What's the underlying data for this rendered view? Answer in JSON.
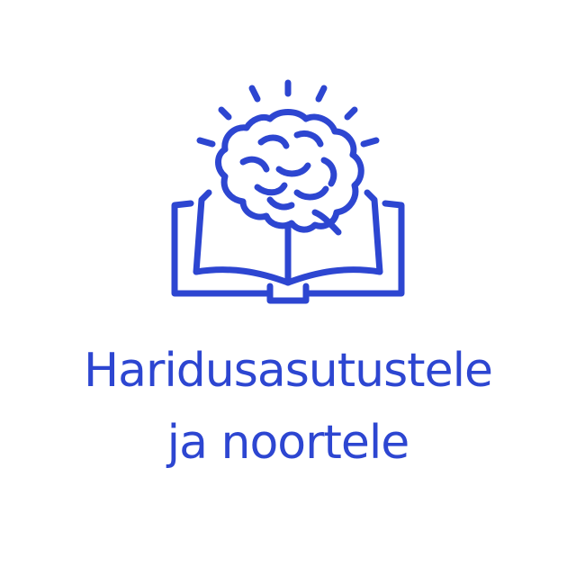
{
  "colors": {
    "accent": "#2d46d1",
    "background": "#ffffff"
  },
  "icon": {
    "name": "brain-book-icon"
  },
  "title": {
    "line1": "Haridusasutustele",
    "line2": "ja noortele"
  }
}
